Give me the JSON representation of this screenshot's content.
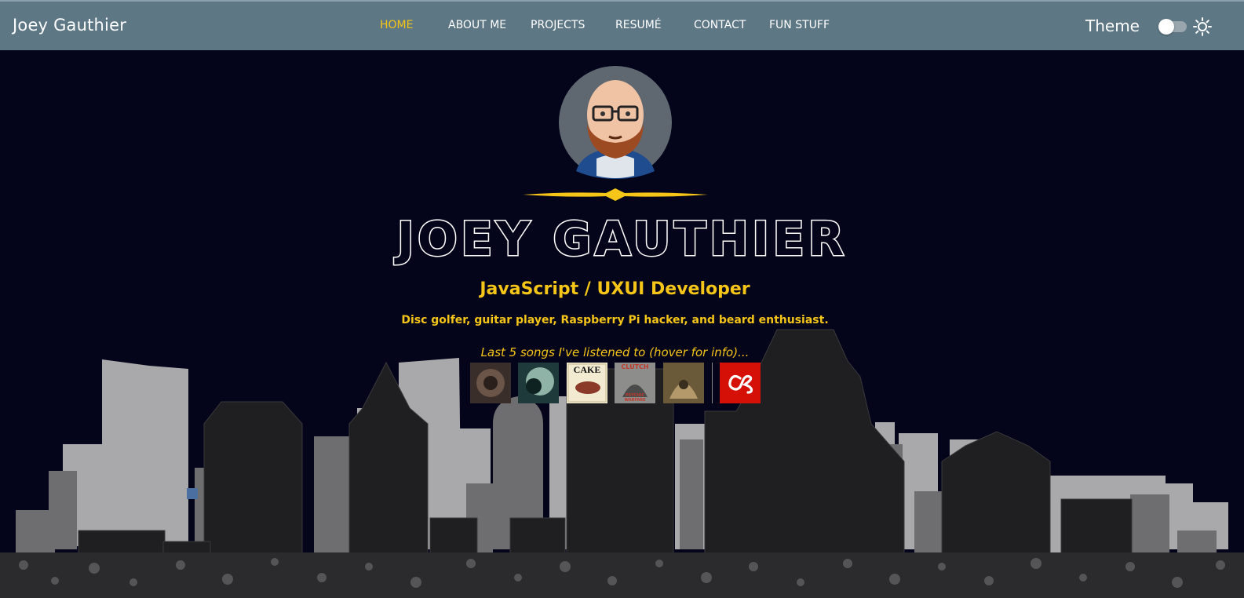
{
  "header": {
    "brand": "Joey Gauthier",
    "nav": [
      {
        "label": "HOME",
        "active": true
      },
      {
        "label": "ABOUT ME",
        "active": false
      },
      {
        "label": "PROJECTS",
        "active": false
      },
      {
        "label": "RESUMÉ",
        "active": false
      },
      {
        "label": "CONTACT",
        "active": false
      },
      {
        "label": "FUN STUFF",
        "active": false
      }
    ],
    "theme_label": "Theme",
    "theme_toggle_on": false
  },
  "hero": {
    "name": "JOEY GAUTHIER",
    "role": "JavaScript / UXUI Developer",
    "bio": "Disc golfer, guitar player, Raspberry Pi hacker, and beard enthusiast.",
    "songs_caption": "Last 5 songs I've listened to (hover for info)...",
    "albums": [
      {
        "name": "album-cover-1"
      },
      {
        "name": "album-cover-2"
      },
      {
        "name": "album-cover-cake",
        "text": "CAKE"
      },
      {
        "name": "album-cover-clutch",
        "text": "CLUTCH",
        "subtext": "PSYCHIC WARFARE"
      },
      {
        "name": "album-cover-5"
      }
    ],
    "lastfm_icon": "lastfm-icon"
  },
  "colors": {
    "background": "#04041a",
    "navbar": "#5d7785",
    "accent": "#f5c518",
    "building_light": "#a9a9ab",
    "building_mid": "#6e6e70",
    "building_dark": "#1f1e20"
  }
}
